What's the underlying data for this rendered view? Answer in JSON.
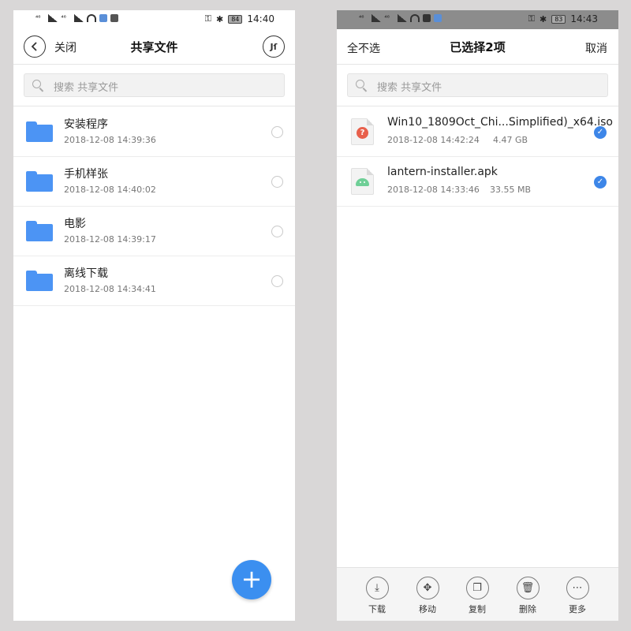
{
  "left": {
    "status": {
      "left_label_1": "⁴⁶",
      "left_label_2": "⁴⁶",
      "battery": "84",
      "time": "14:40"
    },
    "header": {
      "close_label": "关闭",
      "title": "共享文件",
      "sort_label": "Jſ"
    },
    "search": {
      "placeholder": "搜索 共享文件"
    },
    "rows": [
      {
        "name": "安装程序",
        "date": "2018-12-08 14:39:36"
      },
      {
        "name": "手机样张",
        "date": "2018-12-08 14:40:02"
      },
      {
        "name": "电影",
        "date": "2018-12-08 14:39:17"
      },
      {
        "name": "离线下载",
        "date": "2018-12-08 14:34:41"
      }
    ],
    "fab_label": "+"
  },
  "right": {
    "status": {
      "left_label_1": "⁴⁶",
      "left_label_2": "⁴⁶",
      "battery": "83",
      "time": "14:43"
    },
    "header": {
      "deselect_label": "全不选",
      "title": "已选择2项",
      "cancel_label": "取消"
    },
    "search": {
      "placeholder": "搜索 共享文件"
    },
    "rows": [
      {
        "name": "Win10_1809Oct_Chi...Simplified)_x64.iso",
        "date": "2018-12-08 14:42:24",
        "size": "4.47 GB",
        "icon": "iso-file-icon"
      },
      {
        "name": "lantern-installer.apk",
        "date": "2018-12-08 14:33:46",
        "size": "33.55 MB",
        "icon": "apk-file-icon"
      }
    ],
    "toolbar": [
      {
        "label": "下载",
        "glyph": "⤓",
        "icon": "download-icon"
      },
      {
        "label": "移动",
        "glyph": "✥",
        "icon": "move-icon"
      },
      {
        "label": "复制",
        "glyph": "❐",
        "icon": "copy-icon"
      },
      {
        "label": "删除",
        "glyph": "🗑",
        "icon": "delete-icon"
      },
      {
        "label": "更多",
        "glyph": "⋯",
        "icon": "more-icon"
      }
    ]
  },
  "colors": {
    "accent": "#3b8ff0",
    "folder": "#4c94f4",
    "check": "#3d86e8"
  }
}
